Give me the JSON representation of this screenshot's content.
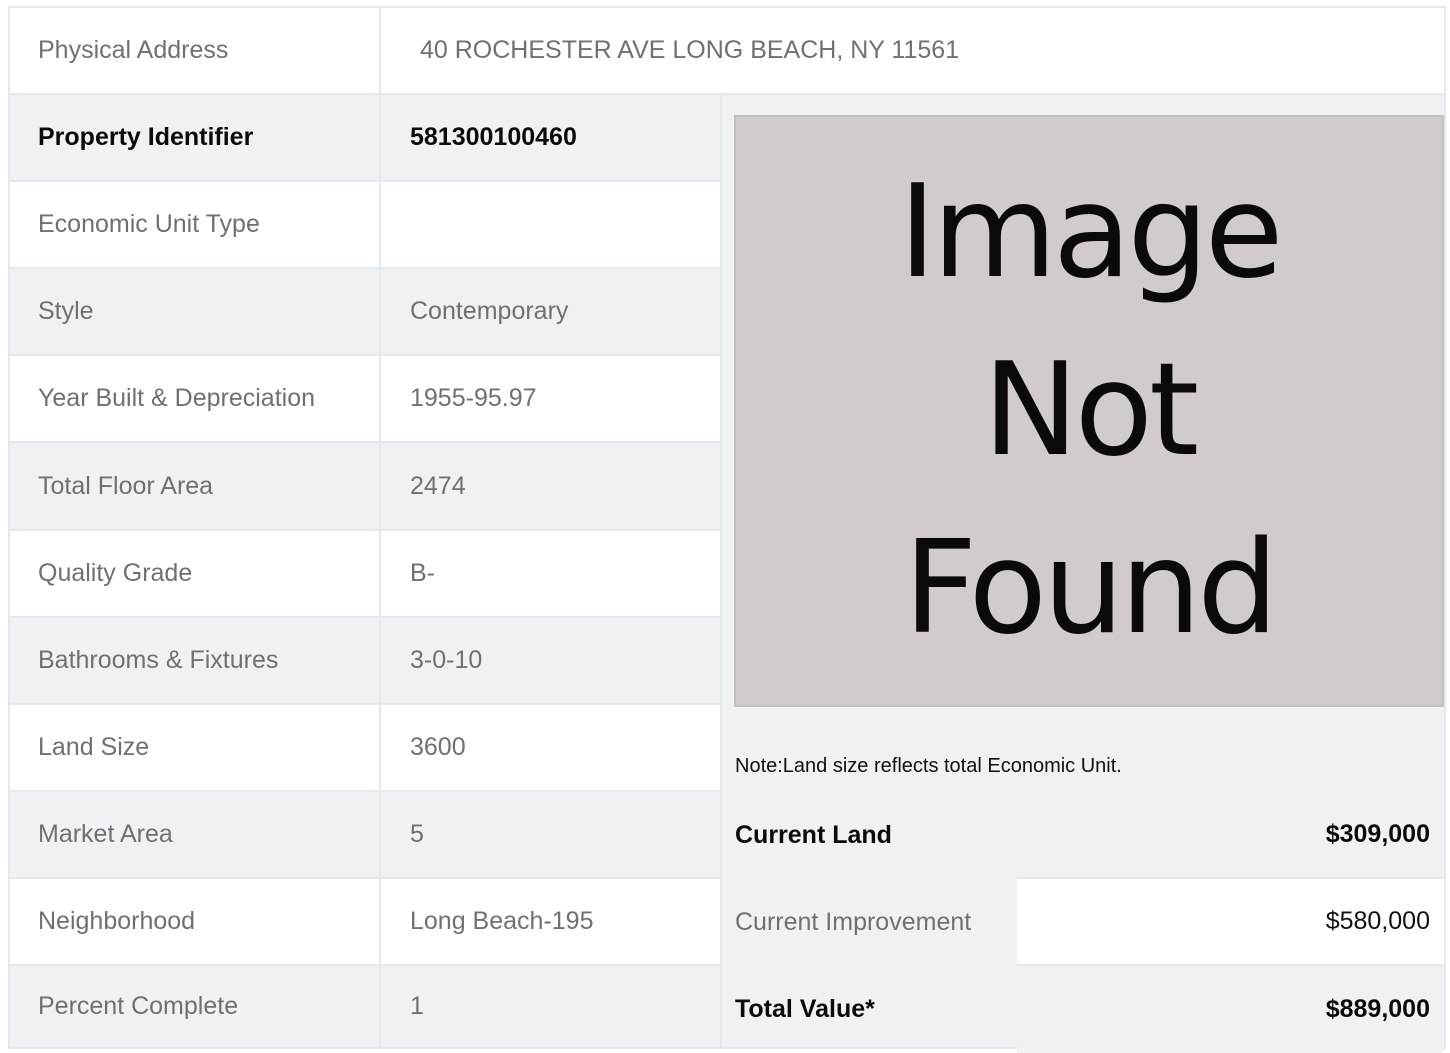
{
  "address": {
    "label": "Physical Address",
    "value": "40  ROCHESTER AVE  LONG BEACH, NY  11561"
  },
  "details": [
    {
      "label": "Property Identifier",
      "value": "581300100460"
    },
    {
      "label": "Economic Unit Type",
      "value": ""
    },
    {
      "label": "Style",
      "value": "Contemporary"
    },
    {
      "label": "Year Built & Depreciation",
      "value": "1955-95.97"
    },
    {
      "label": "Total Floor Area",
      "value": "2474"
    },
    {
      "label": "Quality Grade",
      "value": "B-"
    },
    {
      "label": "Bathrooms & Fixtures",
      "value": "3-0-10"
    },
    {
      "label": "Land Size",
      "value": "3600"
    },
    {
      "label": "Market Area",
      "value": "5"
    },
    {
      "label": "Neighborhood",
      "value": "Long Beach-195"
    },
    {
      "label": "Percent Complete",
      "value": "1"
    }
  ],
  "photo": {
    "line1": "Image",
    "line2": "Not",
    "line3": "Found"
  },
  "note": "Note:Land size reflects total Economic Unit.",
  "valuation": [
    {
      "label": "Current Land",
      "value": "$309,000"
    },
    {
      "label": "Current Improvement",
      "value": "$580,000"
    },
    {
      "label": "Total Value*",
      "value": "$889,000"
    }
  ]
}
